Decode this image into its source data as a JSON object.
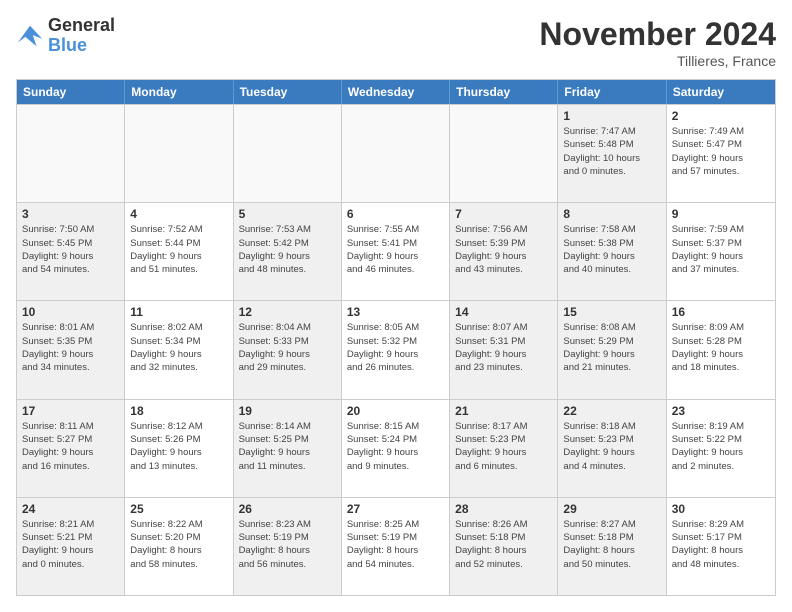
{
  "logo": {
    "line1": "General",
    "line2": "Blue"
  },
  "title": "November 2024",
  "subtitle": "Tillieres, France",
  "header_days": [
    "Sunday",
    "Monday",
    "Tuesday",
    "Wednesday",
    "Thursday",
    "Friday",
    "Saturday"
  ],
  "rows": [
    [
      {
        "day": "",
        "info": "",
        "empty": true
      },
      {
        "day": "",
        "info": "",
        "empty": true
      },
      {
        "day": "",
        "info": "",
        "empty": true
      },
      {
        "day": "",
        "info": "",
        "empty": true
      },
      {
        "day": "",
        "info": "",
        "empty": true
      },
      {
        "day": "1",
        "info": "Sunrise: 7:47 AM\nSunset: 5:48 PM\nDaylight: 10 hours\nand 0 minutes.",
        "shaded": true
      },
      {
        "day": "2",
        "info": "Sunrise: 7:49 AM\nSunset: 5:47 PM\nDaylight: 9 hours\nand 57 minutes.",
        "shaded": false
      }
    ],
    [
      {
        "day": "3",
        "info": "Sunrise: 7:50 AM\nSunset: 5:45 PM\nDaylight: 9 hours\nand 54 minutes.",
        "shaded": true
      },
      {
        "day": "4",
        "info": "Sunrise: 7:52 AM\nSunset: 5:44 PM\nDaylight: 9 hours\nand 51 minutes.",
        "shaded": false
      },
      {
        "day": "5",
        "info": "Sunrise: 7:53 AM\nSunset: 5:42 PM\nDaylight: 9 hours\nand 48 minutes.",
        "shaded": true
      },
      {
        "day": "6",
        "info": "Sunrise: 7:55 AM\nSunset: 5:41 PM\nDaylight: 9 hours\nand 46 minutes.",
        "shaded": false
      },
      {
        "day": "7",
        "info": "Sunrise: 7:56 AM\nSunset: 5:39 PM\nDaylight: 9 hours\nand 43 minutes.",
        "shaded": true
      },
      {
        "day": "8",
        "info": "Sunrise: 7:58 AM\nSunset: 5:38 PM\nDaylight: 9 hours\nand 40 minutes.",
        "shaded": true
      },
      {
        "day": "9",
        "info": "Sunrise: 7:59 AM\nSunset: 5:37 PM\nDaylight: 9 hours\nand 37 minutes.",
        "shaded": false
      }
    ],
    [
      {
        "day": "10",
        "info": "Sunrise: 8:01 AM\nSunset: 5:35 PM\nDaylight: 9 hours\nand 34 minutes.",
        "shaded": true
      },
      {
        "day": "11",
        "info": "Sunrise: 8:02 AM\nSunset: 5:34 PM\nDaylight: 9 hours\nand 32 minutes.",
        "shaded": false
      },
      {
        "day": "12",
        "info": "Sunrise: 8:04 AM\nSunset: 5:33 PM\nDaylight: 9 hours\nand 29 minutes.",
        "shaded": true
      },
      {
        "day": "13",
        "info": "Sunrise: 8:05 AM\nSunset: 5:32 PM\nDaylight: 9 hours\nand 26 minutes.",
        "shaded": false
      },
      {
        "day": "14",
        "info": "Sunrise: 8:07 AM\nSunset: 5:31 PM\nDaylight: 9 hours\nand 23 minutes.",
        "shaded": true
      },
      {
        "day": "15",
        "info": "Sunrise: 8:08 AM\nSunset: 5:29 PM\nDaylight: 9 hours\nand 21 minutes.",
        "shaded": true
      },
      {
        "day": "16",
        "info": "Sunrise: 8:09 AM\nSunset: 5:28 PM\nDaylight: 9 hours\nand 18 minutes.",
        "shaded": false
      }
    ],
    [
      {
        "day": "17",
        "info": "Sunrise: 8:11 AM\nSunset: 5:27 PM\nDaylight: 9 hours\nand 16 minutes.",
        "shaded": true
      },
      {
        "day": "18",
        "info": "Sunrise: 8:12 AM\nSunset: 5:26 PM\nDaylight: 9 hours\nand 13 minutes.",
        "shaded": false
      },
      {
        "day": "19",
        "info": "Sunrise: 8:14 AM\nSunset: 5:25 PM\nDaylight: 9 hours\nand 11 minutes.",
        "shaded": true
      },
      {
        "day": "20",
        "info": "Sunrise: 8:15 AM\nSunset: 5:24 PM\nDaylight: 9 hours\nand 9 minutes.",
        "shaded": false
      },
      {
        "day": "21",
        "info": "Sunrise: 8:17 AM\nSunset: 5:23 PM\nDaylight: 9 hours\nand 6 minutes.",
        "shaded": true
      },
      {
        "day": "22",
        "info": "Sunrise: 8:18 AM\nSunset: 5:23 PM\nDaylight: 9 hours\nand 4 minutes.",
        "shaded": true
      },
      {
        "day": "23",
        "info": "Sunrise: 8:19 AM\nSunset: 5:22 PM\nDaylight: 9 hours\nand 2 minutes.",
        "shaded": false
      }
    ],
    [
      {
        "day": "24",
        "info": "Sunrise: 8:21 AM\nSunset: 5:21 PM\nDaylight: 9 hours\nand 0 minutes.",
        "shaded": true
      },
      {
        "day": "25",
        "info": "Sunrise: 8:22 AM\nSunset: 5:20 PM\nDaylight: 8 hours\nand 58 minutes.",
        "shaded": false
      },
      {
        "day": "26",
        "info": "Sunrise: 8:23 AM\nSunset: 5:19 PM\nDaylight: 8 hours\nand 56 minutes.",
        "shaded": true
      },
      {
        "day": "27",
        "info": "Sunrise: 8:25 AM\nSunset: 5:19 PM\nDaylight: 8 hours\nand 54 minutes.",
        "shaded": false
      },
      {
        "day": "28",
        "info": "Sunrise: 8:26 AM\nSunset: 5:18 PM\nDaylight: 8 hours\nand 52 minutes.",
        "shaded": true
      },
      {
        "day": "29",
        "info": "Sunrise: 8:27 AM\nSunset: 5:18 PM\nDaylight: 8 hours\nand 50 minutes.",
        "shaded": true
      },
      {
        "day": "30",
        "info": "Sunrise: 8:29 AM\nSunset: 5:17 PM\nDaylight: 8 hours\nand 48 minutes.",
        "shaded": false
      }
    ]
  ]
}
